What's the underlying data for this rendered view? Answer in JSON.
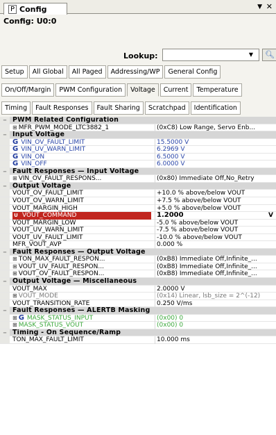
{
  "tab": {
    "icon": "P",
    "title": "Config",
    "dropdown": "▼",
    "close": "✕"
  },
  "config_label": "Config: U0:0",
  "lookup": {
    "label": "Lookup:",
    "value": "",
    "dropdown": "▼",
    "button_icon": "magnifier-icon"
  },
  "buttons_row1": [
    "Setup",
    "All Global",
    "All Paged",
    "Addressing/WP",
    "General Config"
  ],
  "buttons_row2": [
    "On/Off/Margin",
    "PWM Configuration",
    "Voltage",
    "Current",
    "Temperature"
  ],
  "buttons_row3": [
    "Timing",
    "Fault Responses",
    "Fault Sharing",
    "Scratchpad",
    "Identification"
  ],
  "active_button": "Voltage",
  "grid": {
    "rows": [
      {
        "type": "section",
        "name": "PWM Related Configuration"
      },
      {
        "type": "item",
        "exp": "⊞",
        "name": "MFR_PWM_MODE_LTC3882_1",
        "value": "(0xC8) Low Range, Servo Enb..."
      },
      {
        "type": "section",
        "name": "Input Voltage"
      },
      {
        "type": "item",
        "style": "blue",
        "icon": "G",
        "name": "VIN_OV_FAULT_LIMIT",
        "value": "15.5000 V"
      },
      {
        "type": "item",
        "style": "blue",
        "icon": "G",
        "name": "VIN_UV_WARN_LIMIT",
        "value": "6.2969 V"
      },
      {
        "type": "item",
        "style": "blue",
        "icon": "G",
        "name": "VIN_ON",
        "value": "6.5000 V"
      },
      {
        "type": "item",
        "style": "blue",
        "icon": "G",
        "name": "VIN_OFF",
        "value": "6.0000 V"
      },
      {
        "type": "section",
        "name": "Fault Responses — Input Voltage"
      },
      {
        "type": "item",
        "exp": "⊞",
        "name": "VIN_OV_FAULT_RESPONS...",
        "value": "(0x80) Immediate Off,No_Retry"
      },
      {
        "type": "section",
        "name": "Output Voltage"
      },
      {
        "type": "item",
        "name": "VOUT_OV_FAULT_LIMIT",
        "value": "+10.0 % above/below VOUT"
      },
      {
        "type": "item",
        "name": "VOUT_OV_WARN_LIMIT",
        "value": "+7.5 % above/below VOUT"
      },
      {
        "type": "item",
        "name": "VOUT_MARGIN_HIGH",
        "value": "+5.0 % above/below VOUT"
      },
      {
        "type": "item",
        "style": "hl",
        "icon": "U",
        "name": "VOUT_COMMAND",
        "value": "1.2000",
        "mark": "V"
      },
      {
        "type": "item",
        "name": "VOUT_MARGIN_LOW",
        "value": "-5.0 % above/below VOUT"
      },
      {
        "type": "item",
        "name": "VOUT_UV_WARN_LIMIT",
        "value": "-7.5 % above/below VOUT"
      },
      {
        "type": "item",
        "name": "VOUT_UV_FAULT_LIMIT",
        "value": "-10.0 % above/below VOUT"
      },
      {
        "type": "item",
        "name": "MFR_VOUT_AVP",
        "value": "0.000 %"
      },
      {
        "type": "section",
        "name": "Fault Responses — Output Voltage"
      },
      {
        "type": "item",
        "exp": "⊞",
        "name": "TON_MAX_FAULT_RESPON...",
        "value": "(0xB8) Immediate Off,Infinite_..."
      },
      {
        "type": "item",
        "exp": "⊞",
        "name": "VOUT_UV_FAULT_RESPON...",
        "value": "(0xB8) Immediate Off,Infinite_..."
      },
      {
        "type": "item",
        "exp": "⊞",
        "name": "VOUT_OV_FAULT_RESPON...",
        "value": "(0xB8) Immediate Off,Infinite_..."
      },
      {
        "type": "section",
        "name": "Output Voltage — Miscellaneous"
      },
      {
        "type": "item",
        "name": "VOUT_MAX",
        "value": "2.0000 V"
      },
      {
        "type": "item",
        "style": "gray",
        "exp": "⊞",
        "name": "VOUT_MODE",
        "value": "(0x14) Linear, lsb_size = 2^(-12)"
      },
      {
        "type": "item",
        "name": "VOUT_TRANSITION_RATE",
        "value": "0.250 V/ms"
      },
      {
        "type": "section",
        "name": "Fault Responses — ALERTB Masking"
      },
      {
        "type": "item",
        "style": "green",
        "exp": "⊞",
        "icon": "G",
        "name": "MASK_STATUS_INPUT",
        "value": "(0x00) 0"
      },
      {
        "type": "item",
        "style": "green",
        "exp": "⊞",
        "name": "MASK_STATUS_VOUT",
        "value": "(0x00) 0"
      },
      {
        "type": "section",
        "name": "Timing - On Sequence/Ramp"
      },
      {
        "type": "item",
        "name": "TON_MAX_FAULT_LIMIT",
        "value": "10.000 ms"
      }
    ]
  }
}
